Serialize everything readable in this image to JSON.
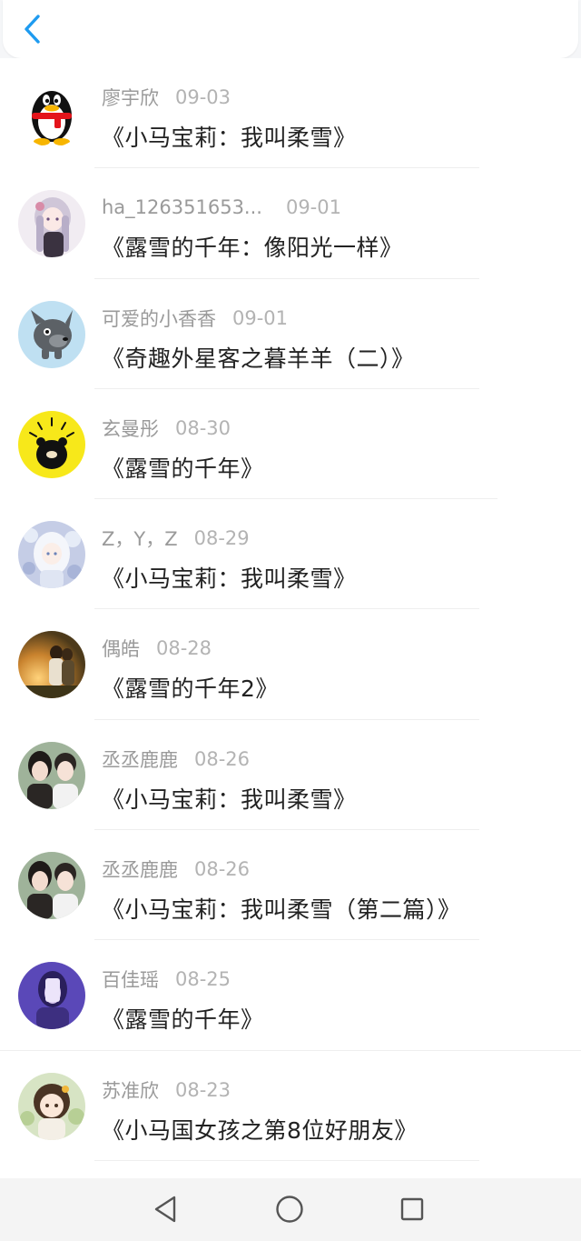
{
  "header": {
    "back_icon": "chevron-left-icon",
    "accent_color": "#1e9bf0"
  },
  "items": [
    {
      "author": "廖宇欣",
      "date": "09-03",
      "title": "《小马宝莉：我叫柔雪》"
    },
    {
      "author": "ha_126351653...",
      "date": "09-01",
      "title": "《露雪的千年：像阳光一样》"
    },
    {
      "author": "可爱的小香香",
      "date": "09-01",
      "title": "《奇趣外星客之暮羊羊（二）》"
    },
    {
      "author": "玄曼彤",
      "date": "08-30",
      "title": "《露雪的千年》"
    },
    {
      "author": "Z，Y，Z",
      "date": "08-29",
      "title": "《小马宝莉：我叫柔雪》"
    },
    {
      "author": "偶皓",
      "date": "08-28",
      "title": "《露雪的千年2》"
    },
    {
      "author": "丞丞鹿鹿",
      "date": "08-26",
      "title": "《小马宝莉：我叫柔雪》"
    },
    {
      "author": "丞丞鹿鹿",
      "date": "08-26",
      "title": "《小马宝莉：我叫柔雪（第二篇）》"
    },
    {
      "author": "百佳瑶",
      "date": "08-25",
      "title": "《露雪的千年》"
    },
    {
      "author": "苏准欣",
      "date": "08-23",
      "title": "《小马国女孩之第8位好朋友》"
    }
  ],
  "navbar": {
    "back_icon": "triangle-back-icon",
    "home_icon": "circle-home-icon",
    "recents_icon": "square-recents-icon"
  }
}
